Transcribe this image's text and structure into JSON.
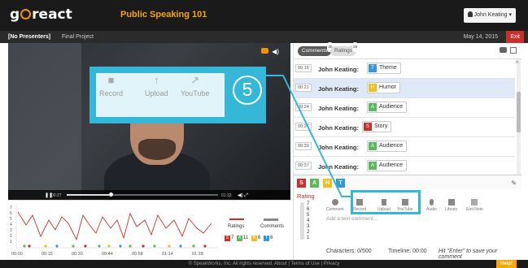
{
  "header": {
    "logo": "goreact",
    "course_title": "Public Speaking 101",
    "user_button": "John Keating"
  },
  "subheader": {
    "presenters": "[No Presenters]",
    "project": "Final Project",
    "date": "May 14, 2015",
    "exit": "Exit"
  },
  "video": {
    "time_current": "00:27",
    "time_total": "01:33"
  },
  "graph": {
    "y_ticks": [
      "7",
      "6",
      "5",
      "4",
      "3",
      "2",
      "1"
    ],
    "x_ticks": [
      "00:00",
      "00:15",
      "00:30",
      "00:44",
      "00:58",
      "01:14",
      "01:28"
    ],
    "legend_ratings": "Ratings",
    "legend_comments": "Comments",
    "counts": [
      {
        "letter": "S",
        "count": "7",
        "color": "#c9302c"
      },
      {
        "letter": "A",
        "count": "11",
        "color": "#5cb85c"
      },
      {
        "letter": "H",
        "count": "6",
        "color": "#f0c020"
      },
      {
        "letter": "T",
        "count": "6",
        "color": "#3498db"
      }
    ]
  },
  "right_panel": {
    "tabs": [
      {
        "label": "Comments",
        "count": "30"
      },
      {
        "label": "Ratings",
        "count": "29"
      }
    ],
    "comments": [
      {
        "time": "00:16",
        "author": "John Keating:",
        "letter": "T",
        "tag": "Theme",
        "color": "#3498db",
        "selected": false
      },
      {
        "time": "00:21",
        "author": "John Keating:",
        "letter": "H",
        "tag": "Humor",
        "color": "#f0c020",
        "selected": true
      },
      {
        "time": "00:24",
        "author": "John Keating:",
        "letter": "A",
        "tag": "Audience",
        "color": "#5cb85c",
        "selected": false
      },
      {
        "time": "00:27",
        "author": "John Keating:",
        "letter": "S",
        "tag": "Story",
        "color": "#c9302c",
        "selected": false
      },
      {
        "time": "00:30",
        "author": "John Keating:",
        "letter": "A",
        "tag": "Audience",
        "color": "#5cb85c",
        "selected": false
      },
      {
        "time": "00:37",
        "author": "John Keating:",
        "letter": "A",
        "tag": "Audience",
        "color": "#5cb85c",
        "selected": false
      }
    ],
    "rating_buttons": [
      {
        "letter": "S",
        "color": "#c9302c"
      },
      {
        "letter": "A",
        "color": "#5cb85c"
      },
      {
        "letter": "H",
        "color": "#f0c020"
      },
      {
        "letter": "T",
        "color": "#3498db"
      }
    ],
    "rating_label": "Rating",
    "rating_values": [
      "7",
      "6",
      "5",
      "4",
      "3",
      "2",
      "1"
    ],
    "toolbar": [
      "Comment",
      "Record",
      "Upload",
      "YouTube",
      "Audio",
      "Library",
      "End Note"
    ],
    "input_placeholder": "Add a text comment...",
    "characters": "Characters: 0/500",
    "timeline": "Timeline: 00:00",
    "hint": "Hit \"Enter\" to save your comment"
  },
  "callout": {
    "number": "5",
    "items": [
      "Record",
      "Upload",
      "YouTube"
    ],
    "color": "#35b7d8"
  },
  "footer": {
    "text": "© SpeakWorks, Inc.   All rights reserved.   About  |  Terms of Use  |  Privacy",
    "help": "Help!"
  }
}
